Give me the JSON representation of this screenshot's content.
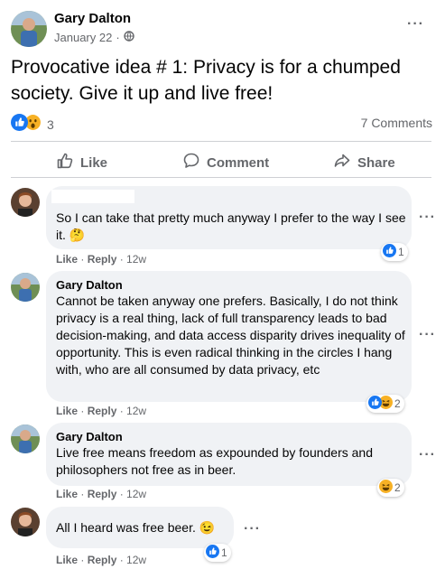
{
  "post": {
    "author": "Gary Dalton",
    "date": "January 22",
    "separator": "·",
    "text": "Provocative idea # 1: Privacy is for a chumped society. Give it up and live free!",
    "reaction_count": "3",
    "comments_count": "7 Comments",
    "menu": "···"
  },
  "actions": {
    "like": "Like",
    "comment": "Comment",
    "share": "Share"
  },
  "comments": [
    {
      "author": "",
      "text": "So I can take that pretty much anyway I prefer to the way I see it.",
      "emoji": "🤔",
      "like": "Like",
      "reply": "Reply",
      "time": "12w",
      "reaction_count": "1"
    },
    {
      "author": "Gary Dalton",
      "text": "Cannot be taken anyway one prefers. Basically, I do not think privacy is a real thing, lack of full transparency leads to bad decision-making, and data access disparity drives inequality of opportunity. This is even radical thinking in the circles I hang with, who are all consumed by data privacy, etc",
      "like": "Like",
      "reply": "Reply",
      "time": "12w",
      "reaction_count": "2"
    },
    {
      "author": "Gary Dalton",
      "text": "Live free means freedom as expounded by founders and philosophers not free as in beer.",
      "like": "Like",
      "reply": "Reply",
      "time": "12w",
      "reaction_count": "2"
    },
    {
      "author": "",
      "text": "All I heard was free beer.",
      "emoji": "😉",
      "like": "Like",
      "reply": "Reply",
      "time": "12w",
      "reaction_count": "1"
    }
  ],
  "colors": {
    "like_blue": "#1877f2",
    "haha_yellow": "#f7b125",
    "text_gray": "#65676b",
    "bubble_bg": "#f0f2f5"
  },
  "icons": [
    "avatar",
    "globe-icon",
    "like-reaction-icon",
    "wow-reaction-icon",
    "haha-reaction-icon",
    "thumbs-up-icon",
    "comment-icon",
    "share-icon",
    "more-icon"
  ]
}
